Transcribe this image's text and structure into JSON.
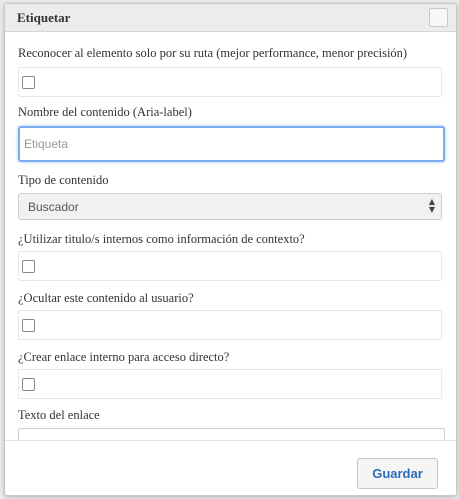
{
  "dialog": {
    "title": "Etiquetar"
  },
  "form": {
    "route_label": "Reconocer al elemento solo por su ruta (mejor performance, menor precisión)",
    "route_checked": false,
    "name_label": "Nombre del contenido (Aria-label)",
    "name_value": "",
    "name_placeholder": "Etiqueta",
    "type_label": "Tipo de contenido",
    "type_selected": "Buscador",
    "titles_label": "¿Utilizar titulo/s internos como información de contexto?",
    "titles_checked": false,
    "hide_label": "¿Ocultar este contenido al usuario?",
    "hide_checked": false,
    "link_label": "¿Crear enlace interno para acceso directo?",
    "link_checked": false,
    "link_text_label": "Texto del enlace",
    "link_text_value": ""
  },
  "footer": {
    "save_label": "Guardar"
  },
  "colors": {
    "accent": "#2b6cb8",
    "focus_ring": "#7aaef0"
  },
  "icons": {
    "select_arrows": "chevron-up-down-icon"
  }
}
